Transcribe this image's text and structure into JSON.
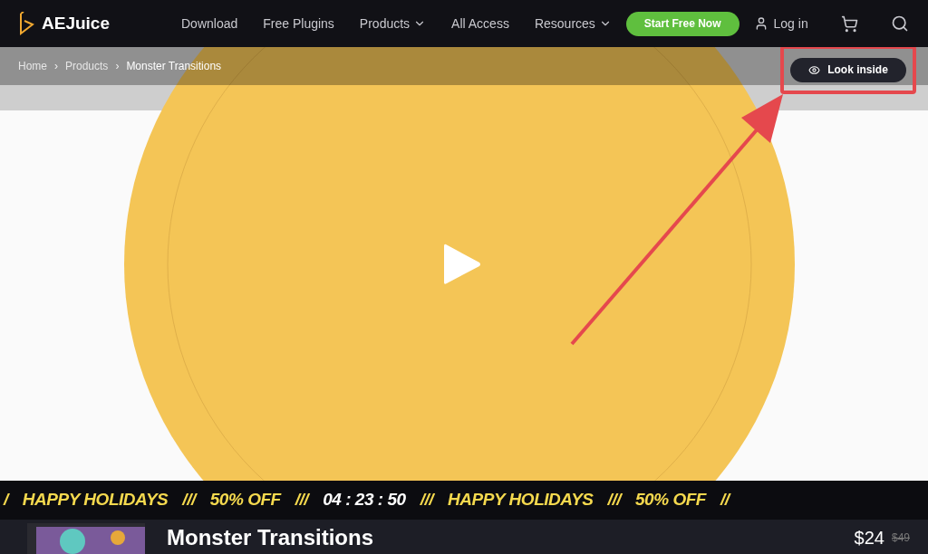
{
  "header": {
    "logo": "AEJuice",
    "nav": [
      {
        "label": "Download",
        "dropdown": false
      },
      {
        "label": "Free Plugins",
        "dropdown": false
      },
      {
        "label": "Products",
        "dropdown": true
      },
      {
        "label": "All Access",
        "dropdown": false
      },
      {
        "label": "Resources",
        "dropdown": true
      }
    ],
    "cta": "Start Free Now",
    "login": "Log in"
  },
  "breadcrumbs": [
    {
      "label": "Home",
      "current": false
    },
    {
      "label": "Products",
      "current": false
    },
    {
      "label": "Monster Transitions",
      "current": true
    }
  ],
  "breadcrumb_separator": "›",
  "video": {
    "kind": "picture",
    "look_inside": "Look inside"
  },
  "ticker": [
    {
      "kind": "sep",
      "text": "/"
    },
    {
      "kind": "text",
      "text": "HAPPY HOLIDAYS"
    },
    {
      "kind": "sep",
      "text": "///"
    },
    {
      "kind": "text",
      "text": "50% OFF"
    },
    {
      "kind": "sep",
      "text": "///"
    },
    {
      "kind": "timer",
      "text": "04 : 23 : 50"
    },
    {
      "kind": "sep",
      "text": "///"
    },
    {
      "kind": "text",
      "text": "HAPPY HOLIDAYS"
    },
    {
      "kind": "sep",
      "text": "///"
    },
    {
      "kind": "text",
      "text": "50% OFF"
    },
    {
      "kind": "sep",
      "text": "//"
    }
  ],
  "product": {
    "title": "Monster Transitions",
    "price": "$24",
    "old_price": "$49"
  }
}
